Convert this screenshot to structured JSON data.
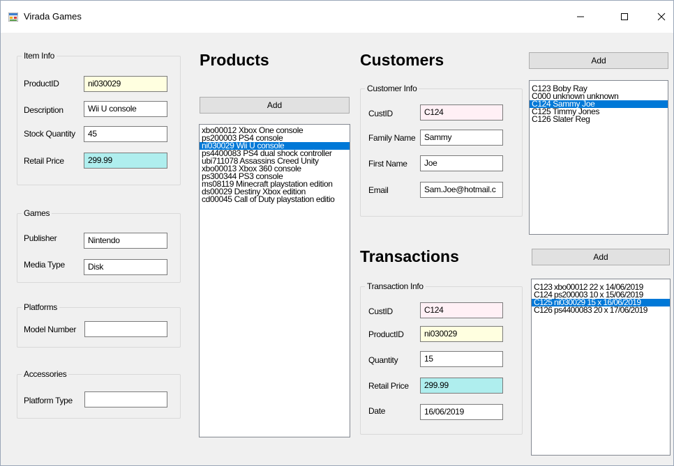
{
  "window": {
    "title": "Virada Games"
  },
  "item_info": {
    "legend": "Item Info",
    "product_id": {
      "label": "ProductID",
      "value": "ni030029"
    },
    "description": {
      "label": "Description",
      "value": "Wii U console"
    },
    "stock_quantity": {
      "label": "Stock Quantity",
      "value": "45"
    },
    "retail_price": {
      "label": "Retail Price",
      "value": "299.99"
    }
  },
  "games": {
    "legend": "Games",
    "publisher": {
      "label": "Publisher",
      "value": "Nintendo"
    },
    "media_type": {
      "label": "Media Type",
      "value": "Disk"
    }
  },
  "platforms": {
    "legend": "Platforms",
    "model_number": {
      "label": "Model Number",
      "value": ""
    }
  },
  "accessories": {
    "legend": "Accessories",
    "platform_type": {
      "label": "Platform Type",
      "value": ""
    }
  },
  "products": {
    "heading": "Products",
    "add_label": "Add",
    "items": [
      {
        "text": "xbo00012 Xbox One console",
        "selected": false
      },
      {
        "text": "ps200003 PS4 console",
        "selected": false
      },
      {
        "text": "ni030029 Wii U console",
        "selected": true
      },
      {
        "text": "ps4400083 PS4 dual shock controller",
        "selected": false
      },
      {
        "text": "ubi711078 Assassins Creed Unity",
        "selected": false
      },
      {
        "text": "xbo00013 Xbox 360 console",
        "selected": false
      },
      {
        "text": "ps300344 PS3 console",
        "selected": false
      },
      {
        "text": "ms08119 Minecraft playstation edition",
        "selected": false
      },
      {
        "text": "ds00029 Destiny Xbox edition",
        "selected": false
      },
      {
        "text": "cd00045 Call of Duty playstation editio",
        "selected": false
      }
    ]
  },
  "customers": {
    "heading": "Customers",
    "add_label": "Add",
    "info": {
      "legend": "Customer Info",
      "cust_id": {
        "label": "CustID",
        "value": "C124"
      },
      "family_name": {
        "label": "Family Name",
        "value": "Sammy"
      },
      "first_name": {
        "label": "First Name",
        "value": "Joe"
      },
      "email": {
        "label": "Email",
        "value": "Sam.Joe@hotmail.c"
      }
    },
    "items": [
      {
        "text": "C123 Boby  Ray",
        "selected": false
      },
      {
        "text": "C000 unknown unknown",
        "selected": false
      },
      {
        "text": "C124 Sammy Joe",
        "selected": true
      },
      {
        "text": "C125 Timmy Jones",
        "selected": false
      },
      {
        "text": "C126 Slater Reg",
        "selected": false
      }
    ]
  },
  "transactions": {
    "heading": "Transactions",
    "add_label": "Add",
    "info": {
      "legend": "Transaction Info",
      "cust_id": {
        "label": "CustID",
        "value": "C124"
      },
      "product_id": {
        "label": "ProductID",
        "value": "ni030029"
      },
      "quantity": {
        "label": "Quantity",
        "value": "15"
      },
      "retail_price": {
        "label": "Retail Price",
        "value": "299.99"
      },
      "date": {
        "label": "Date",
        "value": "16/06/2019"
      }
    },
    "items": [
      {
        "text": "C123 xbo00012 22 x 14/06/2019",
        "selected": false
      },
      {
        "text": "C124 ps200003 10 x 15/06/2019",
        "selected": false
      },
      {
        "text": "C125 ni030029 15 x 16/06/2019",
        "selected": true
      },
      {
        "text": "C126 ps4400083 20 x 17/06/2019",
        "selected": false
      }
    ]
  },
  "colors": {
    "selection": "#0078d7",
    "field_yellow": "#ffffe0",
    "field_pink": "#fff0f5",
    "field_cyan": "#afeeee"
  },
  "icons": {
    "app": "app-form-icon",
    "minimize": "minimize-icon",
    "maximize": "maximize-icon",
    "close": "close-icon"
  }
}
